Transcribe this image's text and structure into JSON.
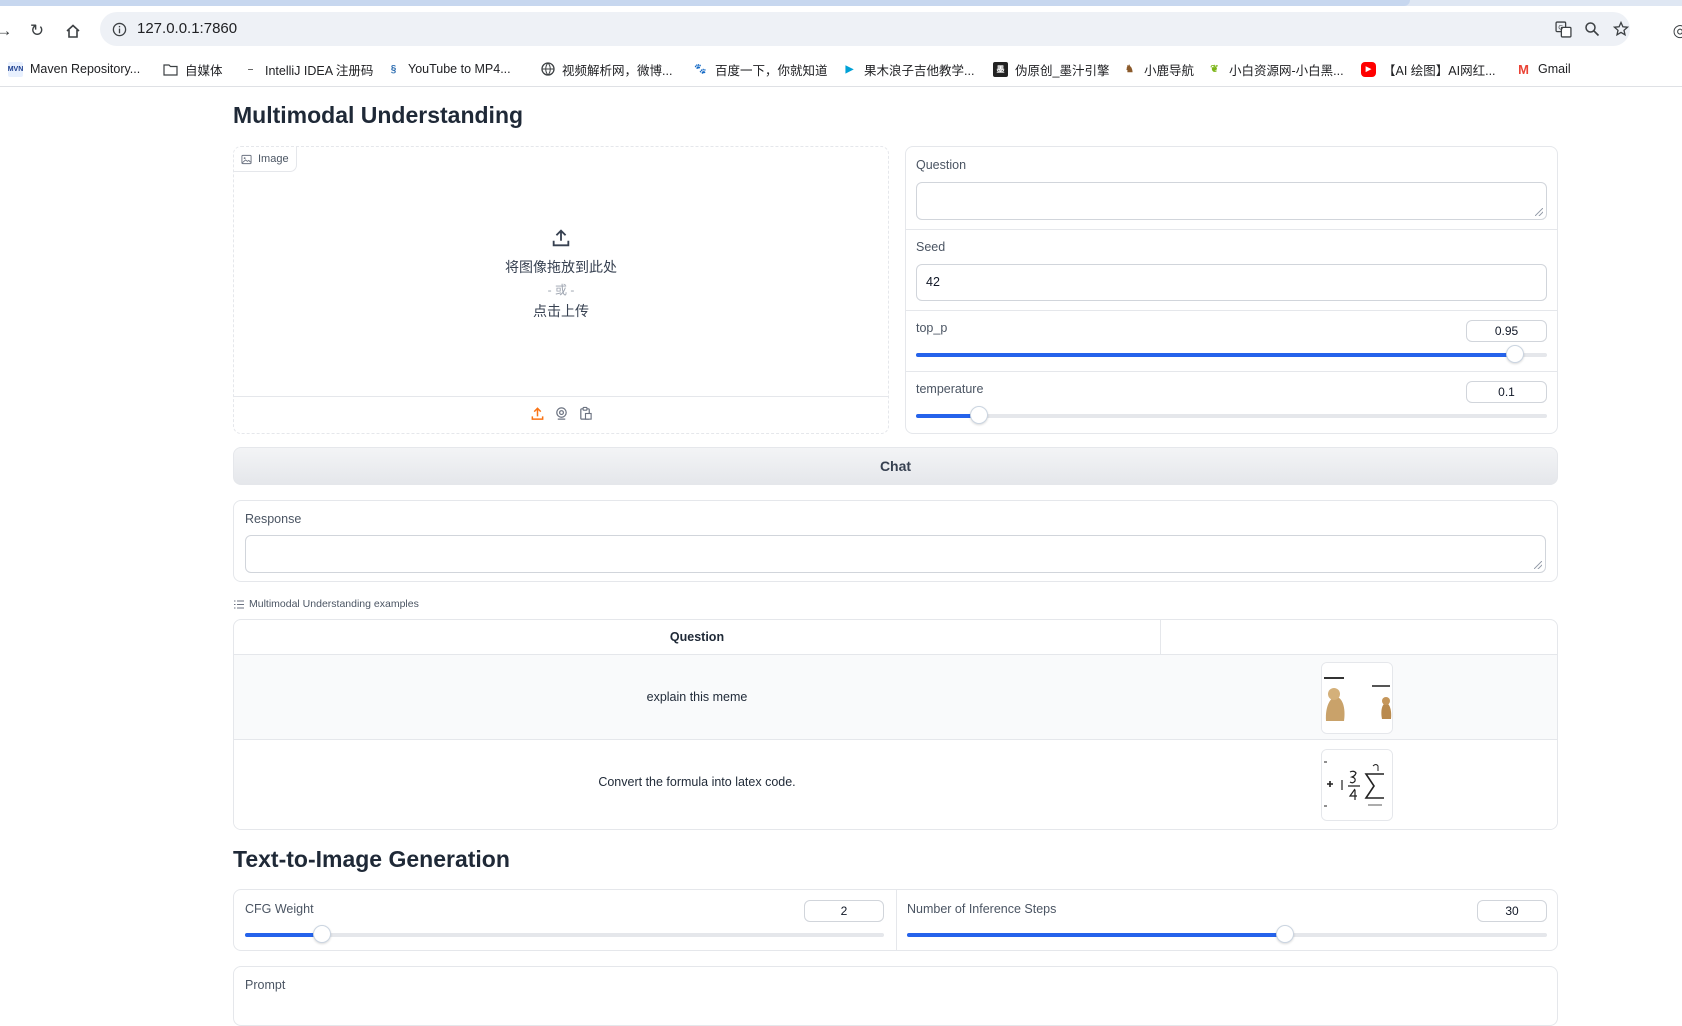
{
  "browser": {
    "url": "127.0.0.1:7860",
    "bookmarks": [
      {
        "label": "Maven Repository...",
        "icon": "maven-icon"
      },
      {
        "label": "自媒体",
        "icon": "folder-icon"
      },
      {
        "label": "IntelliJ IDEA 注册码",
        "icon": "dash-icon"
      },
      {
        "label": "YouTube to MP4...",
        "icon": "link-icon"
      },
      {
        "label": "视频解析网，微博...",
        "icon": "globe-icon"
      },
      {
        "label": "百度一下，你就知道",
        "icon": "baidu-icon"
      },
      {
        "label": "果木浪子吉他教学...",
        "icon": "bilibili-icon"
      },
      {
        "label": "伪原创_墨汁引擎",
        "icon": "engine-icon"
      },
      {
        "label": "小鹿导航",
        "icon": "deer-icon"
      },
      {
        "label": "小白资源网-小白黑...",
        "icon": "leaf-icon"
      },
      {
        "label": "【AI 绘图】AI网红...",
        "icon": "youtube-icon"
      },
      {
        "label": "Gmail",
        "icon": "gmail-icon"
      }
    ]
  },
  "mmu": {
    "title": "Multimodal Understanding",
    "image": {
      "label": "Image",
      "drop_text": "将图像拖放到此处",
      "or_text": "- 或 -",
      "click_text": "点击上传"
    },
    "question_label": "Question",
    "seed_label": "Seed",
    "seed_value": "42",
    "top_p_label": "top_p",
    "top_p_value": "0.95",
    "top_p_fraction": 0.95,
    "temperature_label": "temperature",
    "temperature_value": "0.1",
    "temperature_fraction": 0.1,
    "chat_label": "Chat",
    "response_label": "Response",
    "examples_label": "Multimodal Understanding examples",
    "examples_header": "Question",
    "examples": [
      {
        "question": "explain this meme"
      },
      {
        "question": "Convert the formula into latex code."
      }
    ]
  },
  "t2i": {
    "title": "Text-to-Image Generation",
    "cfg_label": "CFG Weight",
    "cfg_value": "2",
    "cfg_fraction": 0.12,
    "steps_label": "Number of Inference Steps",
    "steps_value": "30",
    "steps_fraction": 0.59,
    "prompt_label": "Prompt"
  }
}
